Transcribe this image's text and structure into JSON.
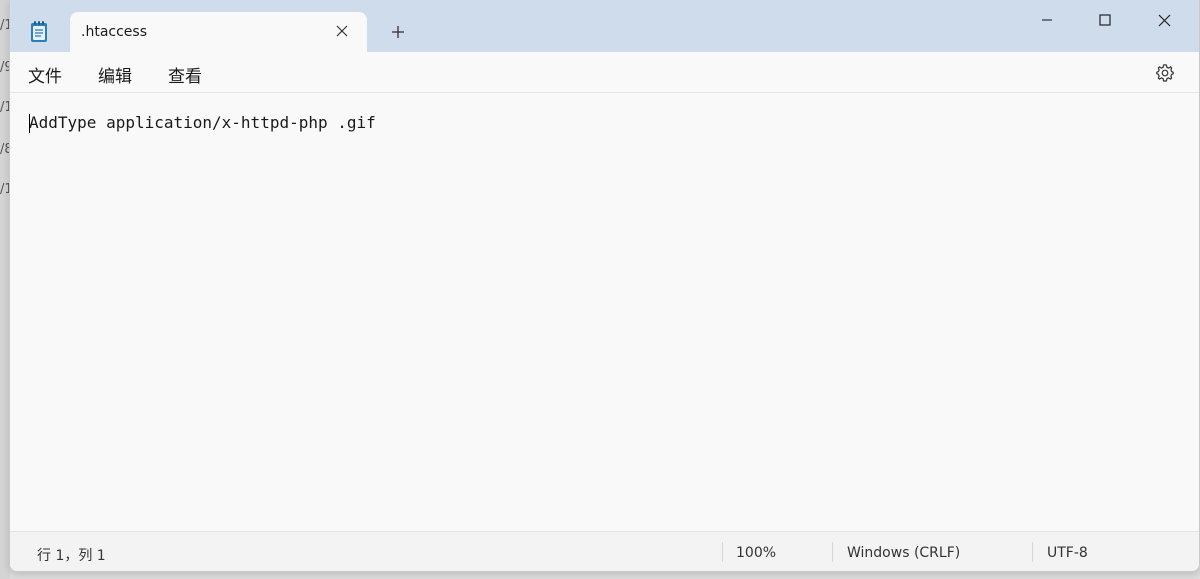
{
  "background": {
    "fragments": [
      "/1",
      "/9",
      "/1",
      "/8",
      "/1"
    ]
  },
  "tab": {
    "title": ".htaccess",
    "close_icon": "close-icon"
  },
  "titlebar": {
    "new_tab_icon": "plus-icon",
    "minimize_icon": "minimize-icon",
    "maximize_icon": "maximize-icon",
    "close_icon": "close-icon"
  },
  "menu": {
    "file": "文件",
    "edit": "编辑",
    "view": "查看",
    "settings_icon": "gear-icon"
  },
  "editor": {
    "content": "AddType application/x-httpd-php .gif"
  },
  "status": {
    "position": "行 1，列 1",
    "zoom": "100%",
    "line_ending": "Windows (CRLF)",
    "encoding": "UTF-8"
  },
  "colors": {
    "titlebar": "#cfdcec",
    "surface": "#f9f9f9",
    "app_icon": "#2c7fb8"
  }
}
